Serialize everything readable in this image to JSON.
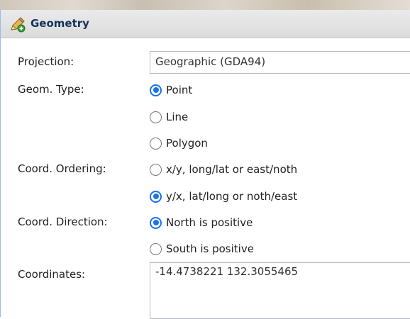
{
  "panel": {
    "title": "Geometry",
    "icon": "geometry-pencil-icon"
  },
  "projection": {
    "label": "Projection:",
    "value": "Geographic (GDA94)"
  },
  "geom_type": {
    "label": "Geom. Type:",
    "options": [
      {
        "label": "Point",
        "selected": true
      },
      {
        "label": "Line",
        "selected": false
      },
      {
        "label": "Polygon",
        "selected": false
      }
    ]
  },
  "coord_ordering": {
    "label": "Coord. Ordering:",
    "options": [
      {
        "label": "x/y, long/lat or east/noth",
        "selected": false
      },
      {
        "label": "y/x, lat/long or noth/east",
        "selected": true
      }
    ]
  },
  "coord_direction": {
    "label": "Coord. Direction:",
    "options": [
      {
        "label": "North is positive",
        "selected": true
      },
      {
        "label": "South is positive",
        "selected": false
      }
    ]
  },
  "coordinates": {
    "label": "Coordinates:",
    "value": "-14.4738221 132.3055465"
  },
  "colors": {
    "header_text": "#15325c",
    "radio_accent": "#1a73e8"
  }
}
